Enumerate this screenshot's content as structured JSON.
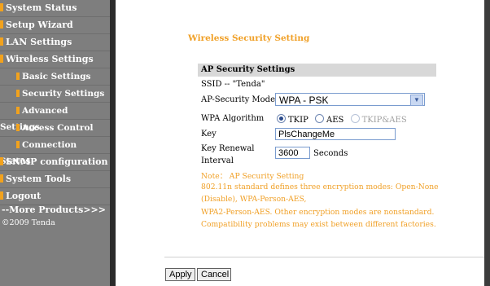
{
  "sidebar": {
    "items": [
      {
        "label": "System Status",
        "sub": false
      },
      {
        "label": "Setup Wizard",
        "sub": false
      },
      {
        "label": "LAN Settings",
        "sub": false
      },
      {
        "label": "Wireless Settings",
        "sub": false
      },
      {
        "label": "Basic Settings",
        "sub": true
      },
      {
        "label": "Security Settings",
        "sub": true
      },
      {
        "label": "Advanced Settings",
        "sub": true
      },
      {
        "label": "Access Control",
        "sub": true
      },
      {
        "label": "Connection Status",
        "sub": true
      },
      {
        "label": "SNMP configuration",
        "sub": false
      },
      {
        "label": "System Tools",
        "sub": false
      },
      {
        "label": "Logout",
        "sub": false
      }
    ],
    "more": "--More Products>>>",
    "copyright": "©2009 Tenda"
  },
  "page": {
    "title": "Wireless Security Setting"
  },
  "panel": {
    "heading": "AP Security Settings",
    "ssid": "SSID -- \"Tenda\"",
    "mode_label": "AP-Security Mode",
    "mode_value": "WPA - PSK",
    "algo_label": "WPA Algorithm",
    "algo_options": [
      {
        "label": "TKIP",
        "checked": true,
        "disabled": false
      },
      {
        "label": "AES",
        "checked": false,
        "disabled": false
      },
      {
        "label": "TKIP&AES",
        "checked": false,
        "disabled": true
      }
    ],
    "key_label": "Key",
    "key_value": "PlsChangeMe",
    "renewal_label_1": "Key Renewal",
    "renewal_label_2": "Interval",
    "renewal_value": "3600",
    "renewal_unit": "Seconds"
  },
  "note": {
    "title": "Note： AP Security Setting",
    "lines": [
      "802.11n standard defines three encryption modes: Open-None",
      "(Disable), WPA-Person-AES,",
      "WPA2-Person-AES. Other encryption modes are nonstandard.",
      "Compatibility problems may exist between different factories."
    ]
  },
  "buttons": {
    "apply": "Apply",
    "cancel": "Cancel"
  },
  "colors": {
    "sidebar_bg": "#7e7e7e",
    "bullet": "#f2a21d",
    "accent_text": "#f0a027"
  }
}
